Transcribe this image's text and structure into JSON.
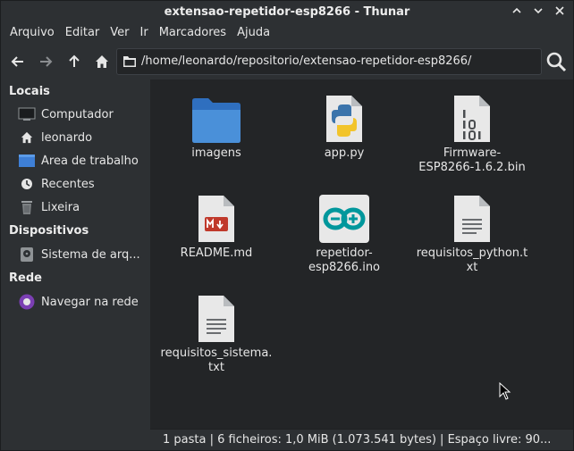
{
  "window": {
    "title": "extensao-repetidor-esp8266 - Thunar"
  },
  "menu": [
    "Arquivo",
    "Editar",
    "Ver",
    "Ir",
    "Marcadores",
    "Ajuda"
  ],
  "location": {
    "path": "/home/leonardo/repositorio/extensao-repetidor-esp8266/"
  },
  "sidebar": {
    "sections": [
      {
        "heading": "Locais",
        "items": [
          {
            "label": "Computador",
            "icon": "computer-icon"
          },
          {
            "label": "leonardo",
            "icon": "home-icon"
          },
          {
            "label": "Área de trabalho",
            "icon": "desktop-icon"
          },
          {
            "label": "Recentes",
            "icon": "clock-icon"
          },
          {
            "label": "Lixeira",
            "icon": "trash-icon"
          }
        ]
      },
      {
        "heading": "Dispositivos",
        "items": [
          {
            "label": "Sistema de arq...",
            "icon": "drive-icon"
          }
        ]
      },
      {
        "heading": "Rede",
        "items": [
          {
            "label": "Navegar na rede",
            "icon": "network-icon"
          }
        ]
      }
    ]
  },
  "files": [
    {
      "name": "imagens",
      "icon": "folder-icon"
    },
    {
      "name": "app.py",
      "icon": "python-file-icon"
    },
    {
      "name": "Firmware-ESP8266-1.6.2.bin",
      "icon": "binary-file-icon"
    },
    {
      "name": "README.md",
      "icon": "markdown-file-icon"
    },
    {
      "name": "repetidor-esp8266.ino",
      "icon": "arduino-file-icon"
    },
    {
      "name": "requisitos_python.txt",
      "icon": "text-file-icon"
    },
    {
      "name": "requisitos_sistema.txt",
      "icon": "text-file-icon"
    }
  ],
  "file_labels": {
    "f0": [
      "imagens"
    ],
    "f1": [
      "app.py"
    ],
    "f2": [
      "Firmware-",
      "ESP8266-1.6.2.bin"
    ],
    "f3": [
      "README.md"
    ],
    "f4": [
      "repetidor-",
      "esp8266.ino"
    ],
    "f5": [
      "requisitos_python.t",
      "xt"
    ],
    "f6": [
      "requisitos_sistema.",
      "txt"
    ]
  },
  "status": {
    "text": "1 pasta  |  6 ficheiros: 1,0 MiB (1.073.541 bytes)  |  Espaço livre: 90..."
  },
  "colors": {
    "folder": "#4a90d9",
    "arduino": "#00979c",
    "markdown": "#c0392b",
    "background": "#232527"
  }
}
